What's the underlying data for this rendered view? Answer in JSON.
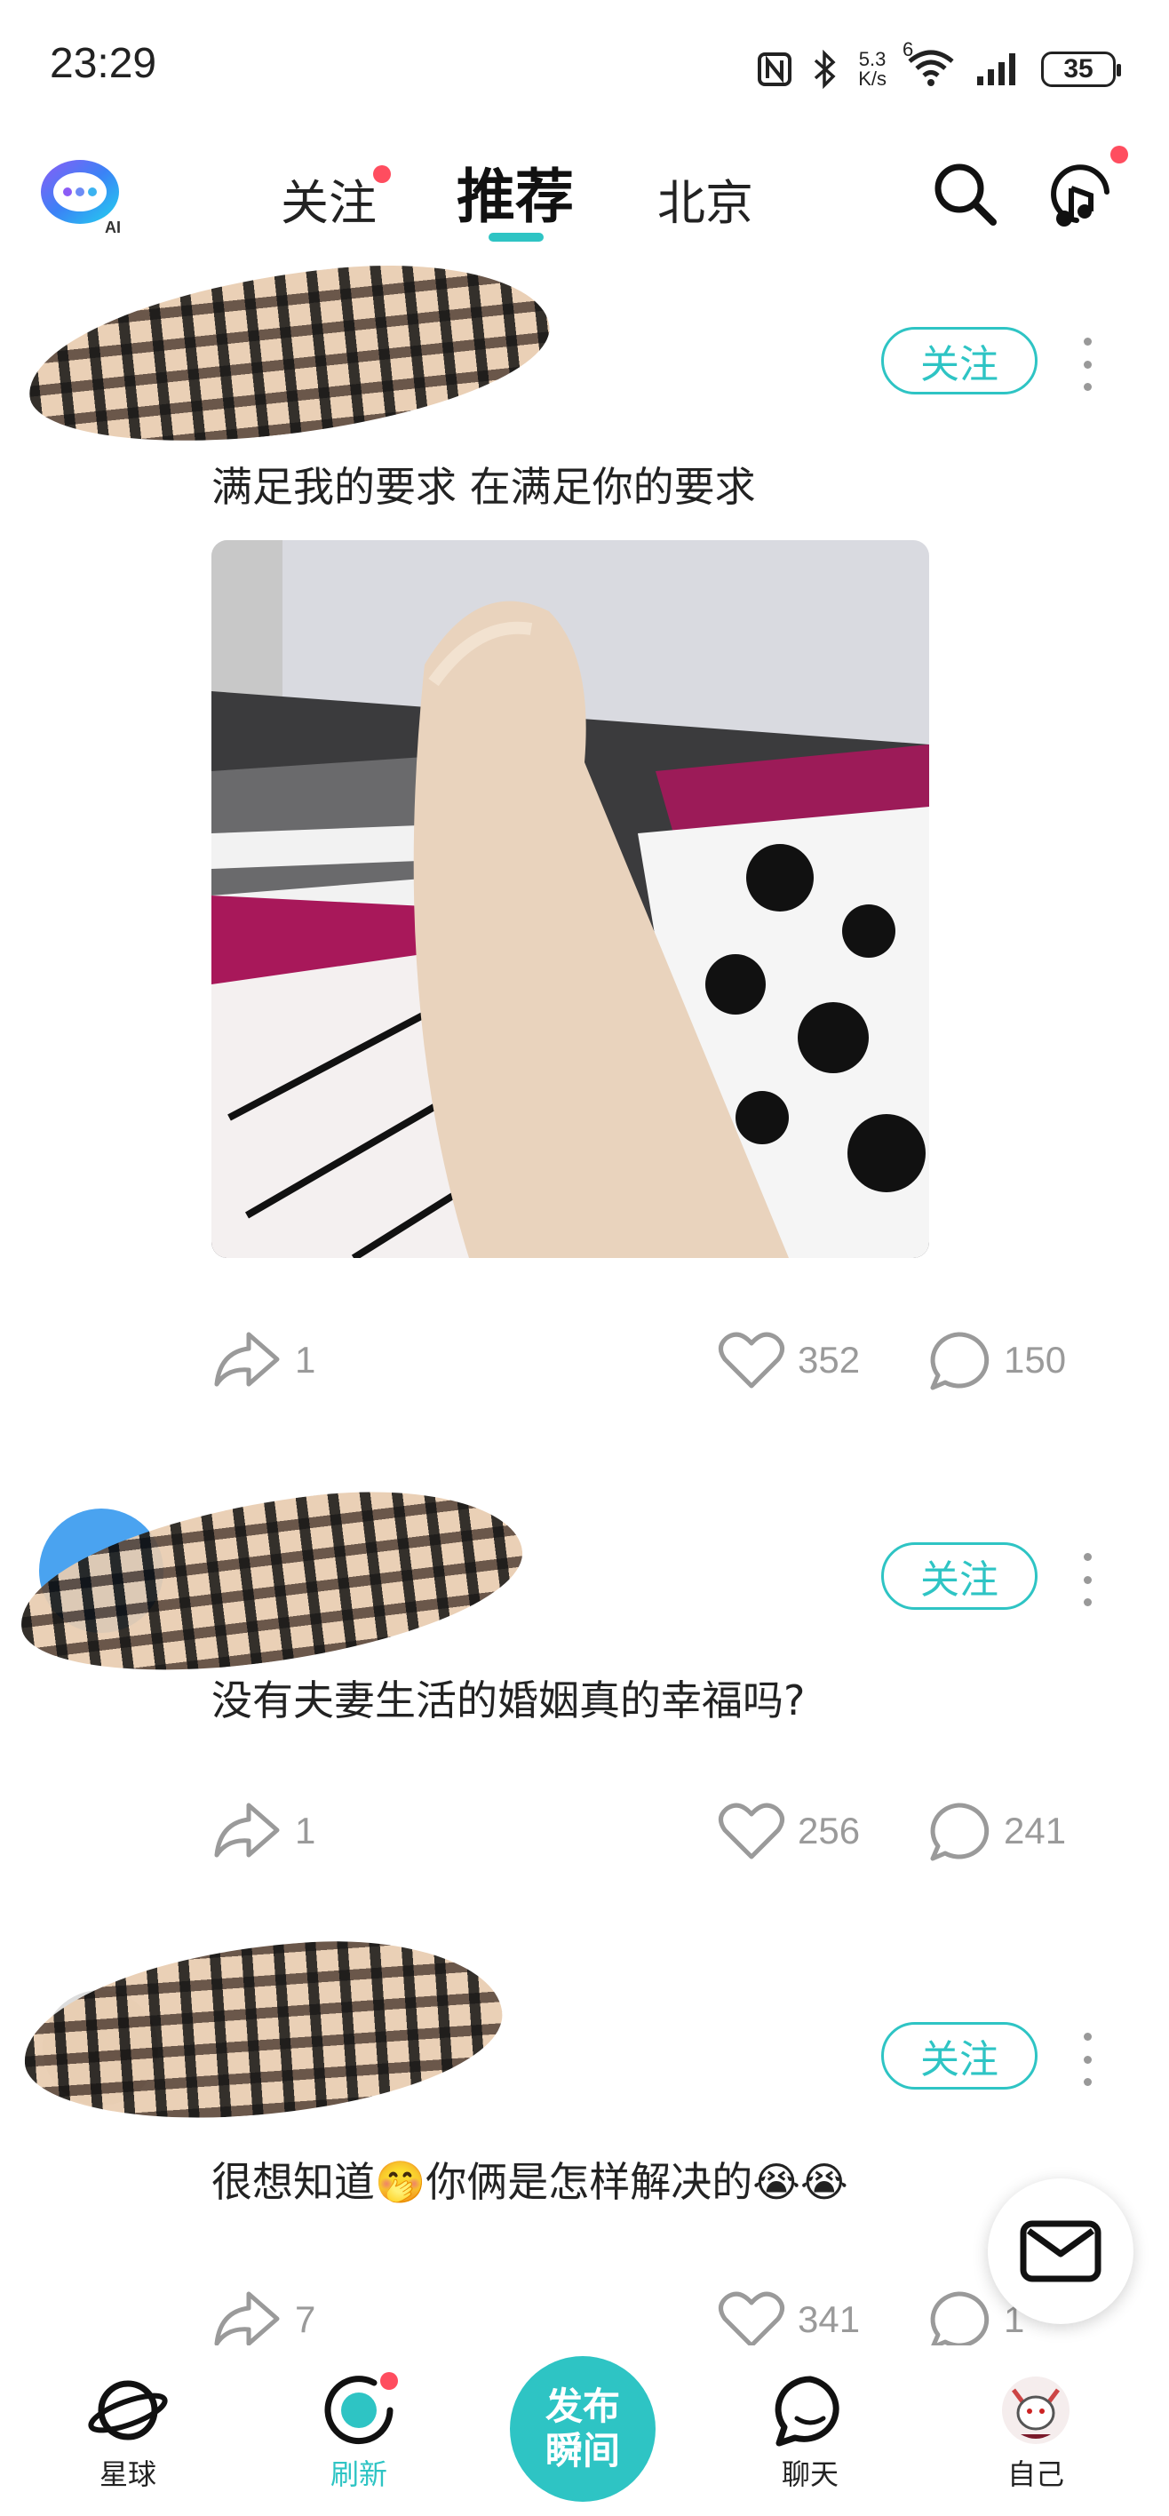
{
  "status_bar": {
    "time": "23:29",
    "net_speed_value": "5.3",
    "net_speed_unit": "K/s",
    "signal_label": "6",
    "battery": "35"
  },
  "top_nav": {
    "tabs": [
      {
        "label": "关注",
        "has_dot": true
      },
      {
        "label": "推荐",
        "active": true
      },
      {
        "label": "北京"
      }
    ],
    "ai_badge": "AI"
  },
  "posts": [
    {
      "follow_label": "关注",
      "text": "满足我的要求 在满足你的要求",
      "share_count": "1",
      "like_count": "352",
      "comment_count": "150",
      "has_image": true
    },
    {
      "follow_label": "关注",
      "text": "没有夫妻生活的婚姻真的幸福吗?",
      "share_count": "1",
      "like_count": "256",
      "comment_count": "241"
    },
    {
      "follow_label": "关注",
      "text_before": "很想知道",
      "text_after": "你俩是怎样解决的",
      "emoji_1": "🤭",
      "emoji_2": "😭😭",
      "share_count": "7",
      "like_count": "341",
      "comment_count": "1"
    }
  ],
  "bottom_nav": {
    "items": [
      {
        "label": "星球"
      },
      {
        "label": "刷新",
        "active": true
      },
      {
        "label": "发布瞬间"
      },
      {
        "label": "聊天"
      },
      {
        "label": "自己"
      }
    ],
    "publish_line1": "发布",
    "publish_line2": "瞬间"
  },
  "colors": {
    "accent": "#2ec4c4",
    "notification_dot": "#ff4d5f",
    "muted": "#9a9a9a"
  }
}
